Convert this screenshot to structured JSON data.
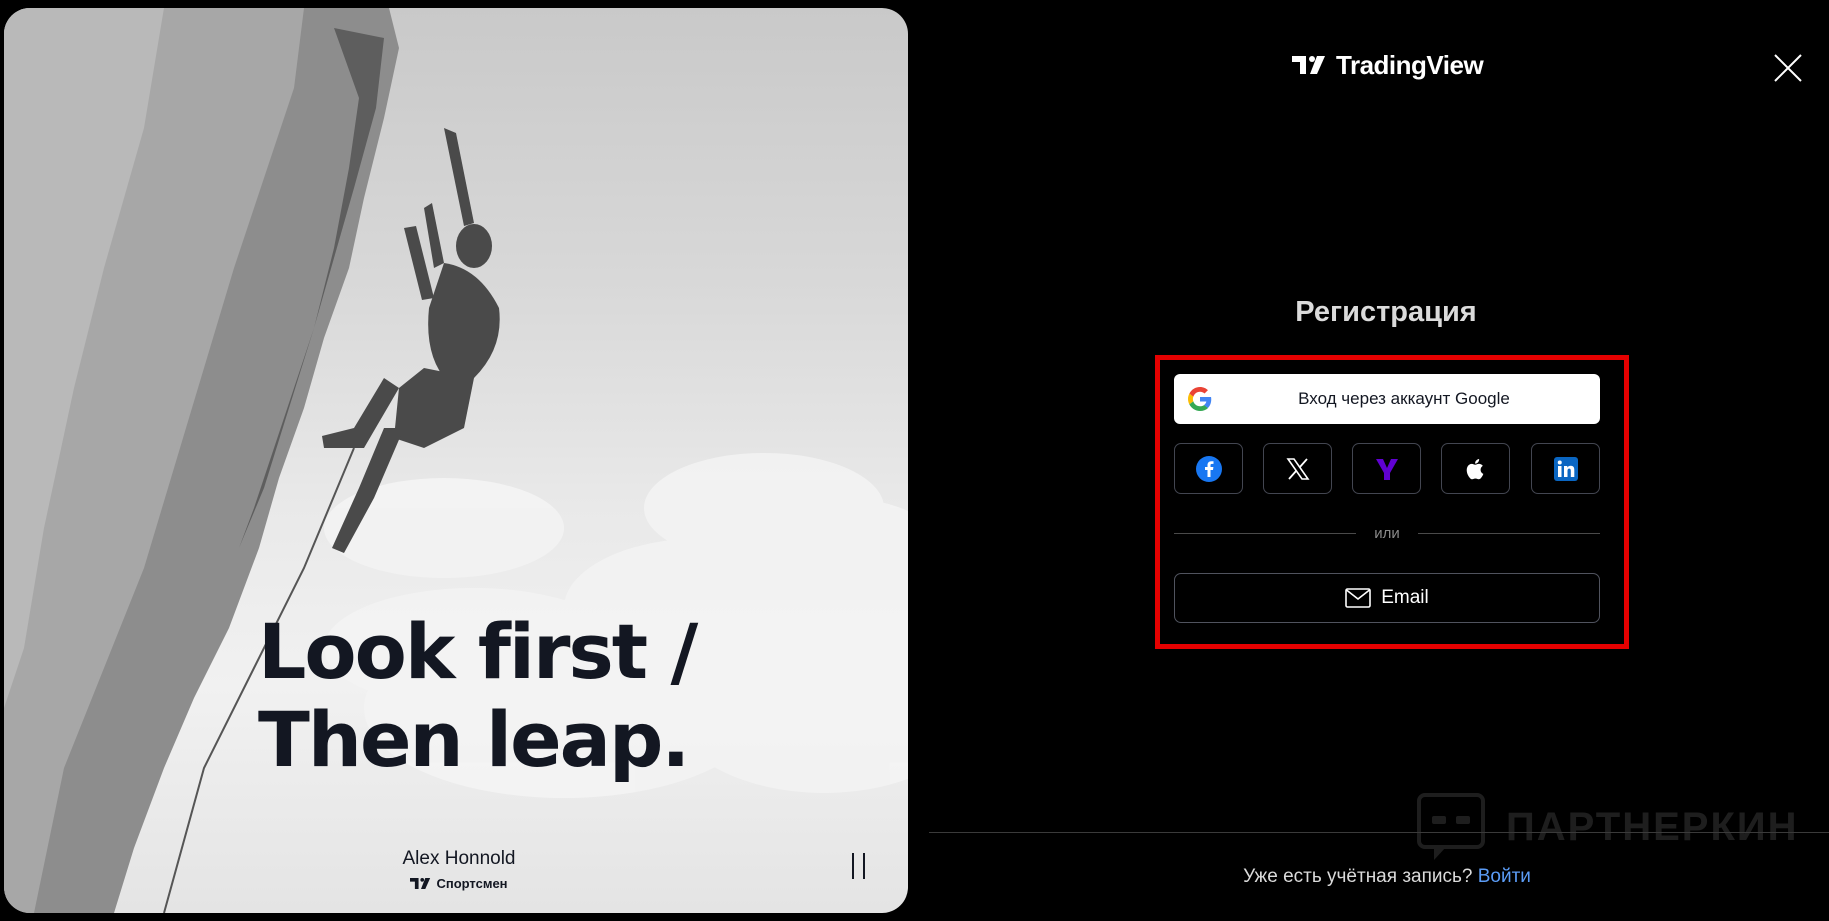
{
  "hero": {
    "headline_line1": "Look first /",
    "headline_line2": "Then leap.",
    "author": "Alex Honnold",
    "role": "Спортсмен",
    "image_icons": [
      "climber-photo",
      "pause-icon"
    ]
  },
  "brand": {
    "name": "TradingView",
    "logo_icon": "tradingview-logo-icon"
  },
  "auth": {
    "title": "Регистрация",
    "google_label": "Вход через аккаунт Google",
    "social": [
      {
        "name": "Facebook",
        "icon": "facebook-icon",
        "color": "#1877f2"
      },
      {
        "name": "X",
        "icon": "x-icon",
        "color": "#ffffff"
      },
      {
        "name": "Yahoo",
        "icon": "yahoo-icon",
        "color": "#6001d2"
      },
      {
        "name": "Apple",
        "icon": "apple-icon",
        "color": "#ffffff"
      },
      {
        "name": "LinkedIn",
        "icon": "linkedin-icon",
        "color": "#0a66c2"
      }
    ],
    "divider_text": "или",
    "email_label": "Email",
    "signin_question": "Уже есть учётная запись?",
    "signin_link": "Войти"
  },
  "watermark": {
    "text": "ПАРТНЕРКИН"
  },
  "colors": {
    "background": "#000000",
    "highlight_border": "#e50000",
    "link": "#5b9cf6",
    "headline": "#131722"
  }
}
